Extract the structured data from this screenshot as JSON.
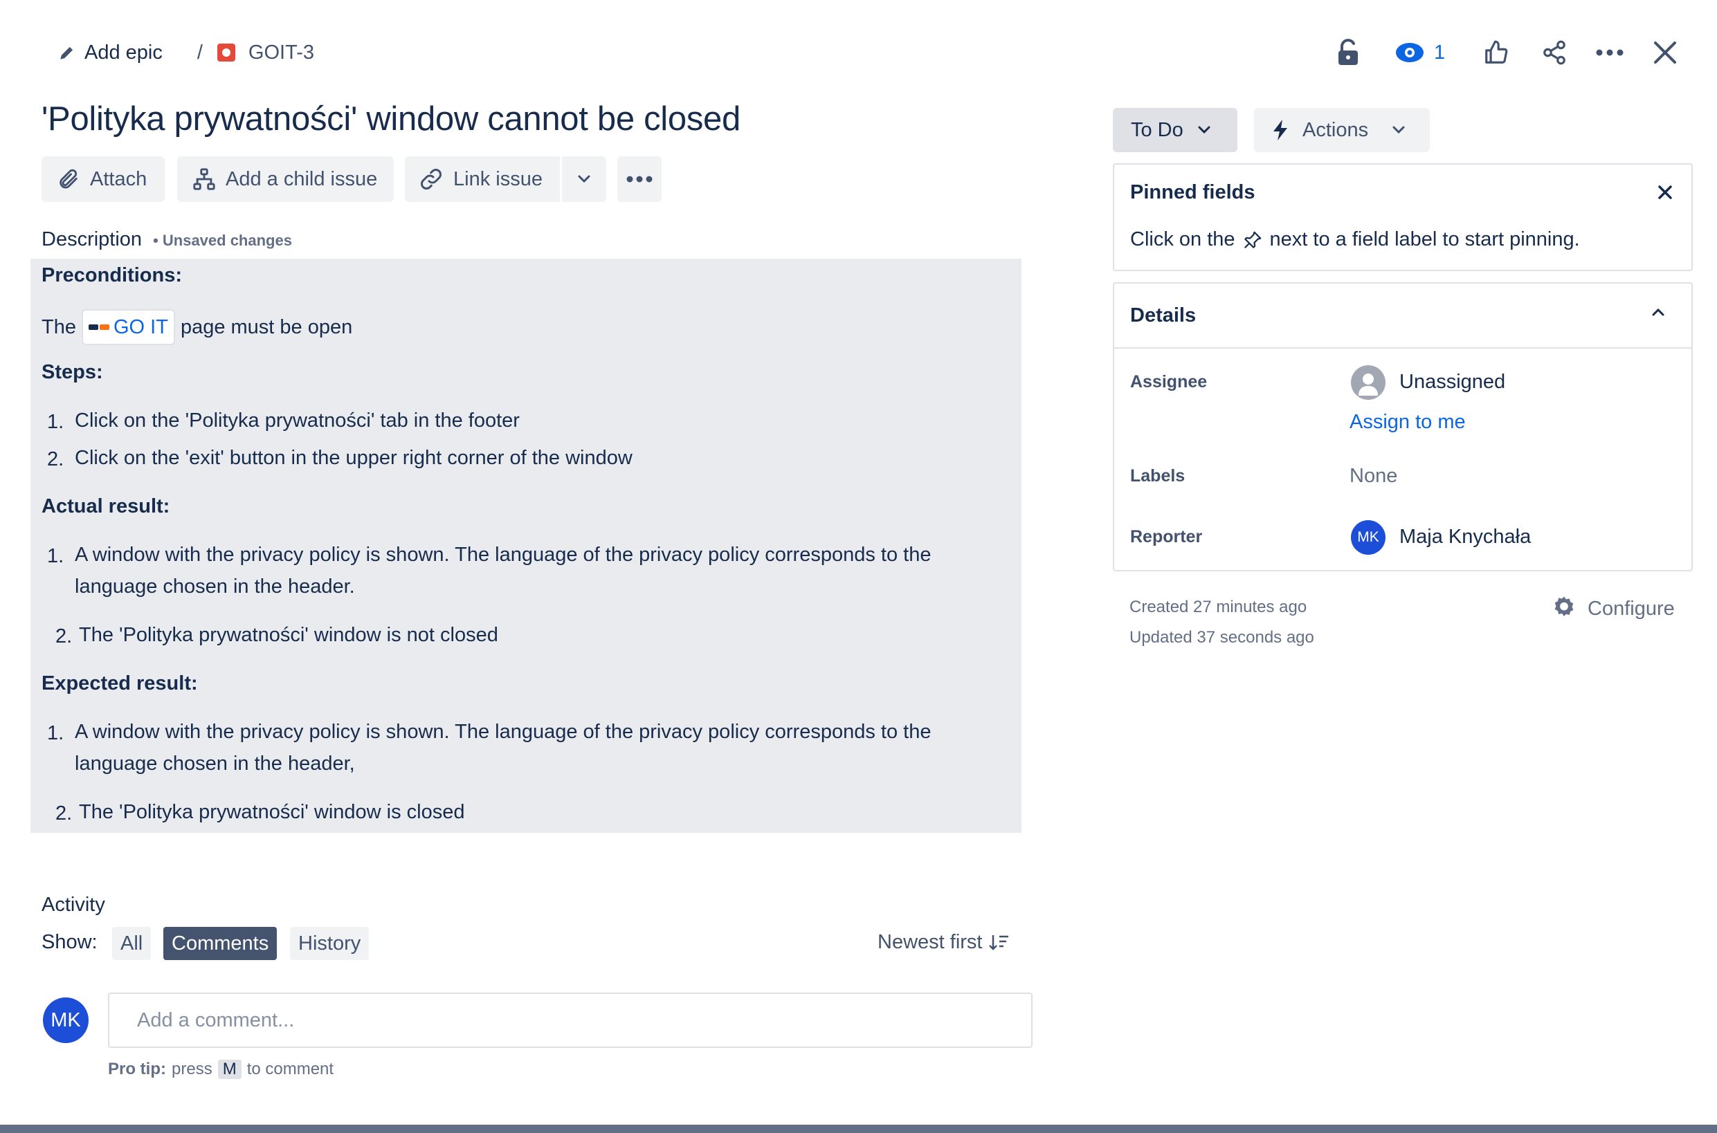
{
  "breadcrumb": {
    "add_epic": "Add epic",
    "separator": "/",
    "issue_key": "GOIT-3"
  },
  "header": {
    "watchers_count": "1"
  },
  "issue": {
    "title": "'Polityka prywatności' window cannot be closed"
  },
  "toolbar": {
    "attach": "Attach",
    "add_child": "Add a child issue",
    "link_issue": "Link issue"
  },
  "description": {
    "label": "Description",
    "unsaved": "• Unsaved changes",
    "preconditions_heading": "Preconditions:",
    "pre_text_before": "The",
    "smartlink": "GO IT",
    "pre_text_after": "page must be open",
    "steps_heading": "Steps:",
    "steps": [
      {
        "num": "1.",
        "text": "Click on the 'Polityka prywatności' tab in the footer"
      },
      {
        "num": "2.",
        "text": "Click on the 'exit' button in the upper right corner of the window"
      }
    ],
    "actual_heading": "Actual result:",
    "actual": [
      {
        "num": "1.",
        "line1": "A window with the privacy policy is shown. The language of the privacy policy corresponds to the",
        "line2": "language chosen in the header."
      },
      {
        "num": "2.",
        "text": "The 'Polityka prywatności' window is not closed"
      }
    ],
    "expected_heading": "Expected result:",
    "expected": [
      {
        "num": "1.",
        "line1": "A window with the privacy policy is shown. The language of the privacy policy corresponds to the",
        "line2": "language chosen in the header,"
      },
      {
        "num": "2.",
        "text": "The 'Polityka prywatności' window is closed"
      }
    ]
  },
  "activity": {
    "label": "Activity",
    "show_label": "Show:",
    "filters": [
      "All",
      "Comments",
      "History"
    ],
    "selected_filter": "Comments",
    "sort": "Newest first",
    "avatar_initials": "MK",
    "comment_placeholder": "Add a comment...",
    "protip_bold": "Pro tip:",
    "protip_press": "press",
    "protip_key": "M",
    "protip_after": "to comment"
  },
  "status": {
    "label": "To Do",
    "actions_label": "Actions"
  },
  "pinned": {
    "title": "Pinned fields",
    "hint_before": "Click on the",
    "hint_after": "next to a field label to start pinning."
  },
  "details": {
    "title": "Details",
    "assignee_label": "Assignee",
    "assignee_value": "Unassigned",
    "assign_to_me": "Assign to me",
    "labels_label": "Labels",
    "labels_value": "None",
    "reporter_label": "Reporter",
    "reporter_initials": "MK",
    "reporter_name": "Maja Knychała"
  },
  "meta": {
    "created": "Created 27 minutes ago",
    "updated": "Updated 37 seconds ago",
    "configure": "Configure"
  },
  "colors": {
    "accent": "#0c66e4",
    "avatar": "#1d4ed8",
    "desc_bg": "#e9ebef",
    "selected_filter_bg": "#44546f"
  }
}
